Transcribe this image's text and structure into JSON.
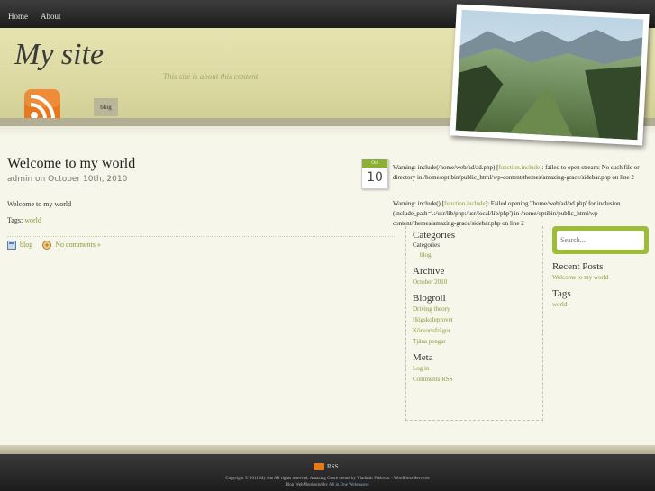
{
  "nav": {
    "home": "Home",
    "about": "About"
  },
  "header": {
    "title": "My site",
    "tagline": "This site is about this content",
    "category_tab": "blog"
  },
  "post": {
    "title": "Welcome to my world",
    "meta": "admin on October 10th, 2010",
    "body": "Welcome to my world",
    "tags_label": "Tags:",
    "tag": "world",
    "category": "blog",
    "comments": "No comments »",
    "date_month": "Oct",
    "date_day": "10"
  },
  "warnings": {
    "w1_prefix": "Warning: include(/home/web/ad/ad.php) [",
    "w1_link": "function.include",
    "w1_suffix": "]: failed to open stream: No such file or directory in /home/optibin/public_html/wp-content/themes/amazing-grace/sidebar.php on line 2",
    "w2_prefix": "Warning: include() [",
    "w2_link": "function.include",
    "w2_suffix": "]: Failed opening '/home/web/ad/ad.php' for inclusion (include_path='.:/usr/lib/php:/usr/local/lib/php') in /home/optibin/public_html/wp-content/themes/amazing-grace/sidebar.php on line 2"
  },
  "sidebar": {
    "categories_head": "Categories",
    "categories_sub": "Categories",
    "categories_item": "blog",
    "archive_head": "Archive",
    "archive_item": "October 2010",
    "blogroll_head": "Blogroll",
    "blogroll_items": [
      "Driving theory",
      "Högskoleprovet",
      "Körkortsfrågor",
      "Tjäna pengar"
    ],
    "meta_head": "Meta",
    "meta_items": [
      "Log in",
      "Comments RSS"
    ],
    "search_placeholder": "Search...",
    "recent_head": "Recent Posts",
    "recent_item": "Welcome to my world",
    "tags_head": "Tags",
    "tags_item": "world"
  },
  "footer": {
    "rss": "RSS",
    "copyright": "Copyright © 2011 My site  All rights reserved. Amazing Grace theme by Vladimir Prelovac - WordPress Services",
    "monitored_prefix": "Blog WebMonitored by",
    "monitored_link": "All in One Webmaster."
  },
  "colors": {
    "accent": "#8a9a3c",
    "search_frame": "#9ebc3c",
    "topbar": "#2a2a2a"
  }
}
